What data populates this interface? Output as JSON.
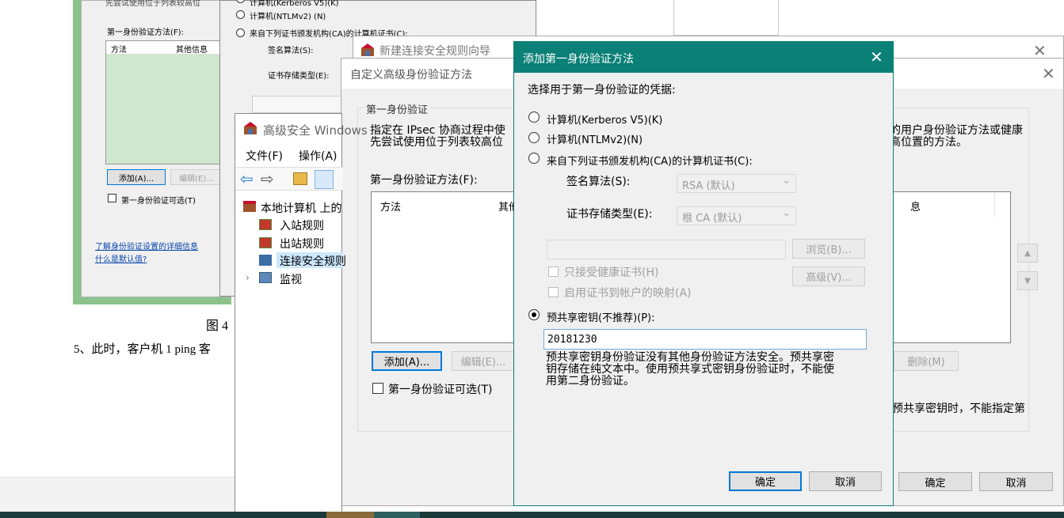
{
  "bg_doc": {
    "figure_caption": "图 4",
    "body_text": "5、此时，客户机 1 ping 客"
  },
  "bg_dialog_1": {
    "truncated_text": "先尝试使用位于列表较高位",
    "label_methods": "第一身份验证方法(F):",
    "col_method": "方法",
    "col_other": "其他信息",
    "add_button": "添加(A)...",
    "edit_button": "编辑(E)...",
    "optional_checkbox": "第一身份验证可选(T)",
    "link_learn": "了解身份验证设置的详细信息",
    "link_default": "什么是默认值?"
  },
  "bg_dialog_2": {
    "opt_kerberos": "计算机(Kerberos V5)(K)",
    "opt_ntlm": "计算机(NTLMv2) (N)",
    "opt_ca": "来自下列证书颁发机构(CA)的计算机证书(C):",
    "sig_label": "签名算法(S):",
    "store_label": "证书存储类型(E):"
  },
  "mmc": {
    "title": "高级安全 Windows",
    "menu": [
      "文件(F)",
      "操作(A)"
    ],
    "tree": {
      "root": "本地计算机 上的",
      "inbound": "入站规则",
      "outbound": "出站规则",
      "connection": "连接安全规则",
      "monitor": "监视"
    }
  },
  "wizard": {
    "title": "新建连接安全规则向导"
  },
  "custom_dialog": {
    "title": "自定义高级身份验证方法",
    "group_title": "第一身份验证",
    "desc_left": "指定在 IPsec 协商过程中使",
    "desc_left_2": "先尝试使用位于列表较高位",
    "desc_right": "的用户身份验证方法或健康",
    "desc_right_2": "高位置的方法。",
    "methods_label": "第一身份验证方法(F):",
    "col_method": "方法",
    "col_other": "其他",
    "col_other_right": "息",
    "add_button": "添加(A)...",
    "edit_button": "编辑(E)...",
    "delete_button": "删除(M)",
    "optional_checkbox": "第一身份验证可选(T)",
    "note_right": "预共享密钥时，不能指定第",
    "ok_button": "确定",
    "cancel_button": "取消"
  },
  "dialog": {
    "title": "添加第一身份验证方法",
    "prompt": "选择用于第一身份验证的凭据:",
    "opt_kerberos": "计算机(Kerberos V5)(K)",
    "opt_ntlm": "计算机(NTLMv2)(N)",
    "opt_ca": "来自下列证书颁发机构(CA)的计算机证书(C):",
    "sig_label": "签名算法(S):",
    "sig_value": "RSA (默认)",
    "store_label": "证书存储类型(E):",
    "store_value": "根 CA (默认)",
    "browse_button": "浏览(B)...",
    "advanced_button": "高级(V)...",
    "health_cert": "只接受健康证书(H)",
    "cert_mapping": "启用证书到帐户的映射(A)",
    "opt_psk": "预共享密钥(不推荐)(P):",
    "psk_value": "20181230",
    "warning_1": "预共享密钥身份验证没有其他身份验证方法安全。预共享密",
    "warning_2": "钥存储在纯文本中。使用预共享式密钥身份验证时，不能使",
    "warning_3": "用第二身份验证。",
    "ok_button": "确定",
    "cancel_button": "取消",
    "selected_option": "psk"
  },
  "colors": {
    "accent": "#0a8077",
    "taskbar": "#1c3a3a",
    "focus": "#0078d7"
  }
}
